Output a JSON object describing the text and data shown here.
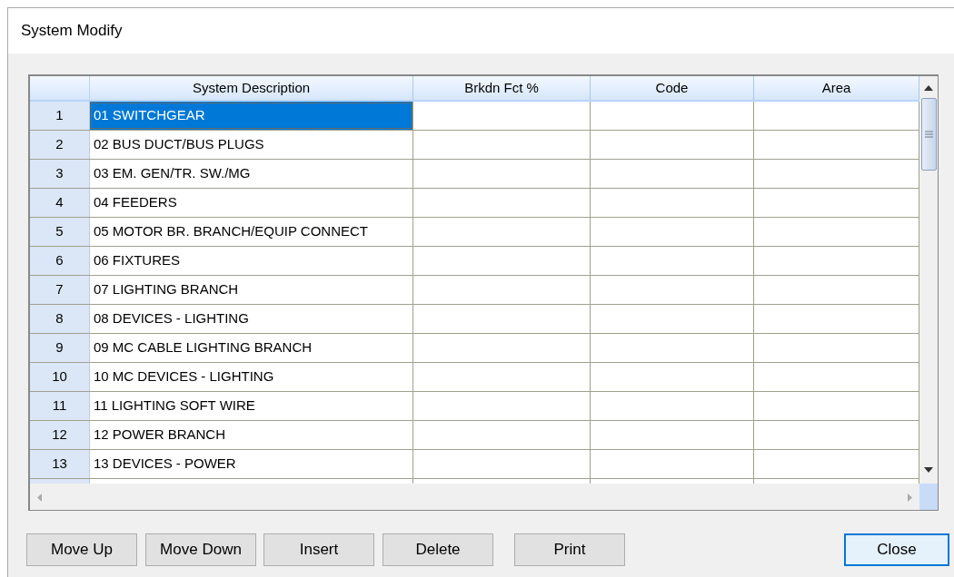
{
  "window": {
    "title": "System Modify"
  },
  "table": {
    "columns": [
      "System Description",
      "Brkdn Fct %",
      "Code",
      "Area"
    ],
    "rows": [
      {
        "number": "1",
        "description": "01 SWITCHGEAR",
        "selected": true
      },
      {
        "number": "2",
        "description": "02 BUS DUCT/BUS PLUGS",
        "selected": false
      },
      {
        "number": "3",
        "description": "03 EM. GEN/TR. SW./MG",
        "selected": false
      },
      {
        "number": "4",
        "description": "04 FEEDERS",
        "selected": false
      },
      {
        "number": "5",
        "description": "05 MOTOR BR. BRANCH/EQUIP CONNECT",
        "selected": false
      },
      {
        "number": "6",
        "description": "06 FIXTURES",
        "selected": false
      },
      {
        "number": "7",
        "description": "07 LIGHTING BRANCH",
        "selected": false
      },
      {
        "number": "8",
        "description": "08 DEVICES - LIGHTING",
        "selected": false
      },
      {
        "number": "9",
        "description": "09 MC CABLE LIGHTING BRANCH",
        "selected": false
      },
      {
        "number": "10",
        "description": "10 MC DEVICES - LIGHTING",
        "selected": false
      },
      {
        "number": "11",
        "description": "11 LIGHTING SOFT WIRE",
        "selected": false
      },
      {
        "number": "12",
        "description": "12 POWER BRANCH",
        "selected": false
      },
      {
        "number": "13",
        "description": "13 DEVICES - POWER",
        "selected": false
      }
    ]
  },
  "buttons": [
    {
      "label": "Move Up",
      "default": false
    },
    {
      "label": "Move Down",
      "default": false
    },
    {
      "label": "Insert",
      "default": false
    },
    {
      "label": "Delete",
      "default": false
    },
    {
      "label": "Print",
      "default": false
    },
    {
      "label": "Close",
      "default": true
    }
  ]
}
